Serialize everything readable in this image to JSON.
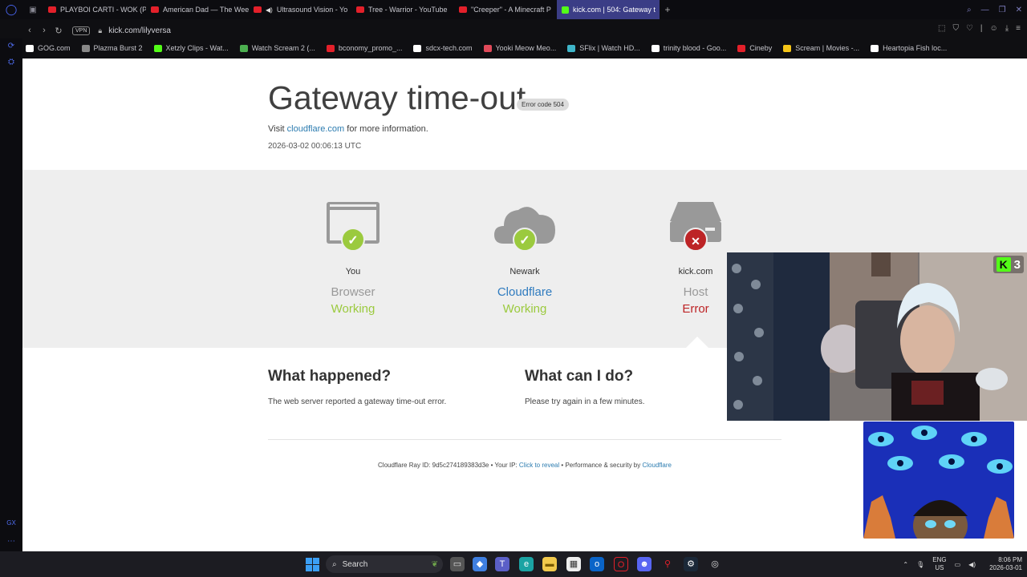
{
  "browser": {
    "tabs": [
      {
        "label": "PLAYBOI CARTI - WOK (P",
        "favicon": "youtube-icon"
      },
      {
        "label": "American Dad — The Wee",
        "favicon": "youtube-icon"
      },
      {
        "label": "Ultrasound Vision - Yo",
        "favicon": "youtube-icon",
        "audio": true
      },
      {
        "label": "Tree - Warrior - YouTube",
        "favicon": "youtube-icon"
      },
      {
        "label": "\"Creeper\" - A Minecraft P",
        "favicon": "youtube-icon"
      },
      {
        "label": "kick.com | 504: Gateway t",
        "favicon": "kick-icon",
        "active": true
      }
    ],
    "new_tab_label": "+",
    "url": "kick.com/lilyversa",
    "vpn_label": "VPN",
    "bookmarks": [
      {
        "label": "GOG.com",
        "color": "#ffffff"
      },
      {
        "label": "Plazma Burst 2",
        "color": "#888888"
      },
      {
        "label": "Xetzly Clips - Wat...",
        "color": "#53fc18"
      },
      {
        "label": "Watch Scream 2 (...",
        "color": "#4caf50"
      },
      {
        "label": "bconomy_promo_...",
        "color": "#e3202a"
      },
      {
        "label": "sdcx-tech.com",
        "color": "#ffffff"
      },
      {
        "label": "Yooki Meow Meo...",
        "color": "#e04a5a"
      },
      {
        "label": "SFlix | Watch HD...",
        "color": "#3fb5c9"
      },
      {
        "label": "trinity blood - Goo...",
        "color": "#ffffff"
      },
      {
        "label": "Cineby",
        "color": "#e3202a"
      },
      {
        "label": "Scream | Movies -...",
        "color": "#f5c518"
      },
      {
        "label": "Heartopia Fish loc...",
        "color": "#ffffff"
      }
    ]
  },
  "page": {
    "title": "Gateway time-out",
    "error_code": "Error code 504",
    "visit_prefix": "Visit",
    "visit_link": "cloudflare.com",
    "visit_suffix": "for more information.",
    "timestamp": "2026-03-02 00:06:13 UTC",
    "nodes": [
      {
        "place": "You",
        "kind": "Browser",
        "state": "Working",
        "ok": true,
        "kind_is_link": false
      },
      {
        "place": "Newark",
        "kind": "Cloudflare",
        "state": "Working",
        "ok": true,
        "kind_is_link": true
      },
      {
        "place": "kick.com",
        "kind": "Host",
        "state": "Error",
        "ok": false,
        "kind_is_link": false
      }
    ],
    "what_happened_title": "What happened?",
    "what_happened_body": "The web server reported a gateway time-out error.",
    "what_can_i_do_title": "What can I do?",
    "what_can_i_do_body": "Please try again in a few minutes.",
    "footer": {
      "ray_label": "Cloudflare Ray ID:",
      "ray_id": "9d5c274189383d3e",
      "ip_label": "Your IP:",
      "ip_link": "Click to reveal",
      "perf_label": "Performance & security by",
      "perf_link": "Cloudflare",
      "separator": "•"
    }
  },
  "overlay": {
    "viewer_count": "3"
  },
  "taskbar": {
    "search_label": "Search",
    "lang_line1": "ENG",
    "lang_line2": "US",
    "time": "8:06 PM",
    "date": "2026-03-01"
  },
  "colors": {
    "working": "#9bca3e",
    "error": "#bd2426",
    "link": "#2c7cb0",
    "kick_green": "#53fc18",
    "active_tab": "#3b3d86"
  }
}
